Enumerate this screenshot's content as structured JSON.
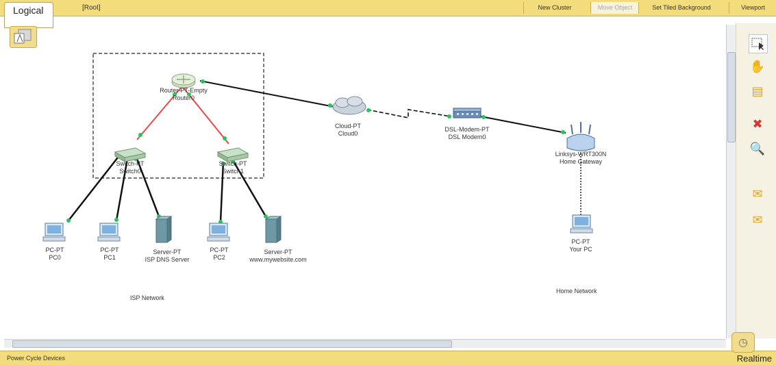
{
  "toolbar": {
    "mode": "Logical",
    "breadcrumb": "[Root]",
    "buttons": {
      "new_cluster": "New Cluster",
      "move_object": "Move Object",
      "set_tiled_background": "Set Tiled Background",
      "viewport": "Viewport"
    }
  },
  "devices": {
    "router0": {
      "model": "Router-PT-Empty",
      "name": "Router0"
    },
    "switch0": {
      "model": "Switch-PT",
      "name": "Switch0"
    },
    "switch1": {
      "model": "Switch-PT",
      "name": "Switch1"
    },
    "cloud0": {
      "model": "Cloud-PT",
      "name": "Cloud0"
    },
    "dslmodem0": {
      "model": "DSL-Modem-PT",
      "name": "DSL Modem0"
    },
    "gateway": {
      "model": "Linksys-WRT300N",
      "name": "Home Gateway"
    },
    "pc0": {
      "model": "PC-PT",
      "name": "PC0"
    },
    "pc1": {
      "model": "PC-PT",
      "name": "PC1"
    },
    "server_dns": {
      "model": "Server-PT",
      "name": "ISP DNS Server"
    },
    "pc2": {
      "model": "PC-PT",
      "name": "PC2"
    },
    "server_web": {
      "model": "Server-PT",
      "name": "www.mywebsite.com"
    },
    "yourpc": {
      "model": "PC-PT",
      "name": "Your PC"
    }
  },
  "notes": {
    "isp": "ISP Network",
    "home": "Home Network"
  },
  "status": {
    "left": "Power Cycle Devices",
    "mode": "Realtime"
  },
  "colors": {
    "toolbar": "#f3dc7c",
    "link_ok": "#22c55e",
    "link_red": "#ef4444",
    "cable": "#111111"
  },
  "icons": [
    "select-icon",
    "hand-icon",
    "note-icon",
    "delete-icon",
    "zoom-icon",
    "pdu-icon",
    "complex-pdu-icon",
    "realtime-clock-icon"
  ]
}
